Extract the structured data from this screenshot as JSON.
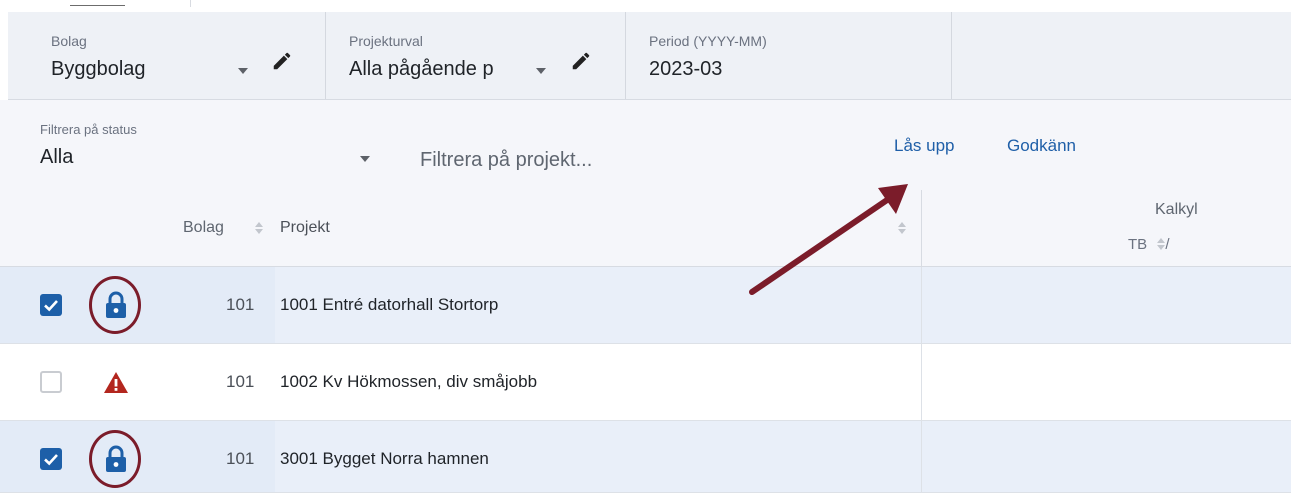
{
  "header": {
    "bolag": {
      "label": "Bolag",
      "value": "Byggbolag"
    },
    "projekturval": {
      "label": "Projekturval",
      "value": "Alla pågående p"
    },
    "period": {
      "label": "Period (YYYY-MM)",
      "value": "2023-03"
    }
  },
  "filter": {
    "status_label": "Filtrera på status",
    "status_value": "Alla",
    "project_placeholder": "Filtrera på projekt...",
    "unlock_label": "Lås upp",
    "approve_label": "Godkänn"
  },
  "table": {
    "columns": {
      "bolag": "Bolag",
      "projekt": "Projekt",
      "group": "Kalkyl",
      "tb": "TB"
    },
    "rows": [
      {
        "checked": true,
        "status_icon": "lock-icon",
        "bolag": "101",
        "projekt": "1001 Entré datorhall Stortorp"
      },
      {
        "checked": false,
        "status_icon": "warning-icon",
        "bolag": "101",
        "projekt": "1002 Kv Hökmossen, div småjobb"
      },
      {
        "checked": true,
        "status_icon": "lock-icon",
        "bolag": "101",
        "projekt": "3001 Bygget Norra hamnen"
      }
    ]
  },
  "colors": {
    "accent": "#1d5fa8",
    "annotation": "#7b1c2a",
    "warning": "#b3261e",
    "selected_row": "#e9eff9"
  }
}
